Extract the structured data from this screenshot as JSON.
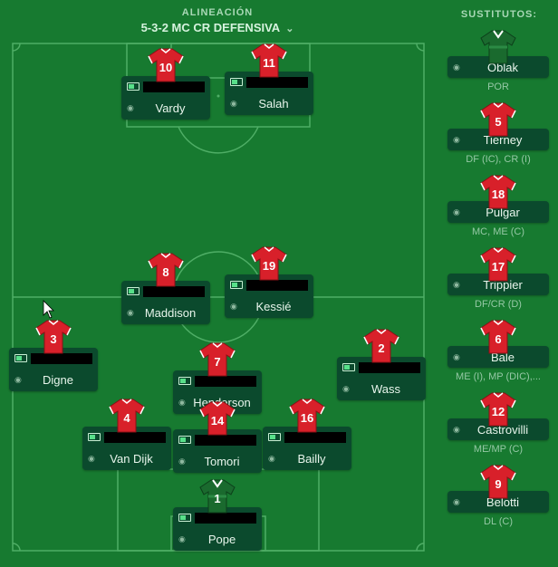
{
  "header": {
    "label": "ALINEACIÓN",
    "formation": "5-3-2 MC CR DEFENSIVA",
    "chevron": "⌄"
  },
  "substitutes_title": "SUSTITUTOS:",
  "colors": {
    "pitch": "#177a30",
    "card": "#0b4a2d",
    "shirt_red": "#d8202a",
    "gk_green": "#1a6a2e"
  },
  "players": [
    {
      "name": "Vardy",
      "number": "10",
      "kit": "red"
    },
    {
      "name": "Salah",
      "number": "11",
      "kit": "red"
    },
    {
      "name": "Maddison",
      "number": "8",
      "kit": "red"
    },
    {
      "name": "Kessié",
      "number": "19",
      "kit": "red"
    },
    {
      "name": "Digne",
      "number": "3",
      "kit": "red"
    },
    {
      "name": "Henderson",
      "number": "7",
      "kit": "red"
    },
    {
      "name": "Wass",
      "number": "2",
      "kit": "red"
    },
    {
      "name": "Van Dijk",
      "number": "4",
      "kit": "red"
    },
    {
      "name": "Tomori",
      "number": "14",
      "kit": "red"
    },
    {
      "name": "Bailly",
      "number": "16",
      "kit": "red"
    },
    {
      "name": "Pope",
      "number": "1",
      "kit": "gk"
    }
  ],
  "substitutes": [
    {
      "name": "Oblak",
      "number": "",
      "kit": "gk",
      "position": "POR"
    },
    {
      "name": "Tierney",
      "number": "5",
      "kit": "red",
      "position": "DF (IC), CR (I)"
    },
    {
      "name": "Pulgar",
      "number": "18",
      "kit": "red",
      "position": "MC, ME (C)"
    },
    {
      "name": "Trippier",
      "number": "17",
      "kit": "red",
      "position": "DF/CR (D)"
    },
    {
      "name": "Bale",
      "number": "6",
      "kit": "red",
      "position": "ME (I), MP (DIC),..."
    },
    {
      "name": "Castrovilli",
      "number": "12",
      "kit": "red",
      "position": "ME/MP (C)"
    },
    {
      "name": "Belotti",
      "number": "9",
      "kit": "red",
      "position": "DL (C)"
    }
  ]
}
